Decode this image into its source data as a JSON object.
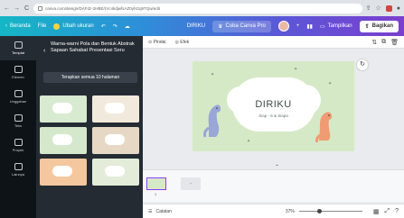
{
  "browser": {
    "url": "canva.com/design/DAFdz-2HBE/rVc4kdjwfsAZ0yhGq9TQw/edit",
    "back": "←",
    "forward": "→",
    "reload": "C"
  },
  "header": {
    "home_label": "Beranda",
    "file_label": "File",
    "resize_label": "Ubah ukuran",
    "undo": "↶",
    "redo": "↷",
    "design_name": "DIRIKU",
    "try_pro_label": "Coba Canva Pro",
    "present_label": "Tampilkan",
    "share_label": "Bagikan"
  },
  "rail": [
    {
      "label": "Templat",
      "icon": "template-icon"
    },
    {
      "label": "Elemen",
      "icon": "elements-icon"
    },
    {
      "label": "Unggahan",
      "icon": "upload-icon"
    },
    {
      "label": "Teks",
      "icon": "text-icon"
    },
    {
      "label": "Proyek",
      "icon": "folder-icon"
    },
    {
      "label": "Lainnya",
      "icon": "more-icon"
    }
  ],
  "panel": {
    "title": "Warna-warni Pola dan Bentuk Abstrak Sapaan Sahabat Presentasi Seru",
    "apply_all_label": "Terapkan semua 10 halaman"
  },
  "toolbar": {
    "effects_label": "Pindai",
    "animate_label": "Efek"
  },
  "slide": {
    "title": "DIRIKU",
    "subtitle": "Siap - 6 & Siapa"
  },
  "pages": {
    "current": "1",
    "add": "+"
  },
  "footer": {
    "notes_label": "Catatan",
    "zoom": "37%"
  },
  "colors": {
    "accent": "#8b3dff",
    "slide_bg": "#d6e9c7"
  }
}
